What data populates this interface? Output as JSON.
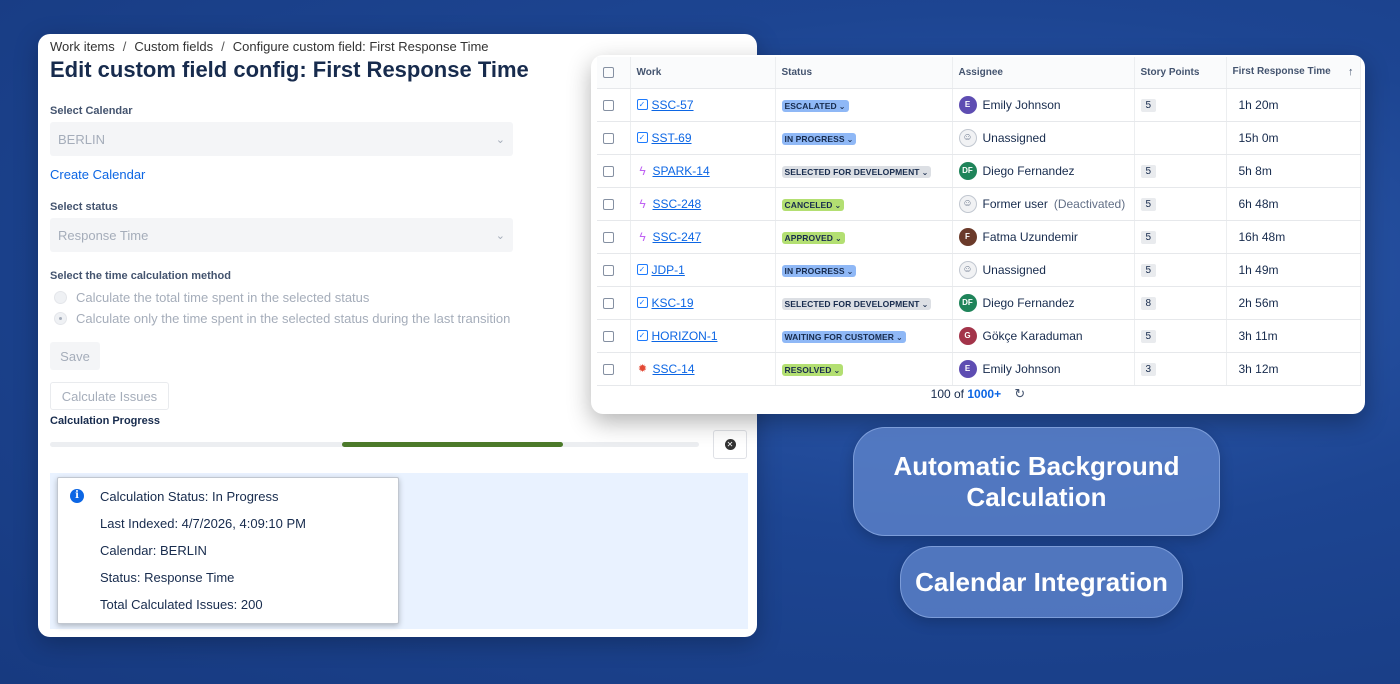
{
  "config": {
    "breadcrumb": [
      "Work items",
      "Custom fields",
      "Configure custom field: First Response Time"
    ],
    "title": "Edit custom field config: First Response Time",
    "calendar_label": "Select Calendar",
    "calendar_value": "BERLIN",
    "create_calendar_link": "Create Calendar",
    "status_label": "Select status",
    "status_value": "Response Time",
    "method_label": "Select the time calculation method",
    "method_options": [
      "Calculate the total time spent in the selected status",
      "Calculate only the time spent in the selected status during the last transition"
    ],
    "method_selected_index": 1,
    "save_label": "Save",
    "calculate_label": "Calculate Issues",
    "progress_label": "Calculation Progress",
    "progress_fraction_start": 0.45,
    "progress_fraction_end": 0.79,
    "info": {
      "status": "Calculation Status: In Progress",
      "last_indexed": "Last Indexed: 4/7/2026, 4:09:10 PM",
      "calendar": "Calendar: BERLIN",
      "status_name": "Status: Response Time",
      "total": "Total Calculated Issues: 200"
    }
  },
  "table": {
    "headers": [
      "Work",
      "Status",
      "Assignee",
      "Story Points",
      "First Response Time"
    ],
    "sort_indicator": "↑",
    "rows": [
      {
        "type": "task",
        "key": "SSC-57",
        "status": "ESCALATED",
        "status_color": "#8fb8f6",
        "assignee": "Emily Johnson",
        "avatar": "E",
        "avatar_color": "#5e4db2",
        "deactivated": "",
        "points": "5",
        "frt": "1h 20m"
      },
      {
        "type": "task",
        "key": "SST-69",
        "status": "IN PROGRESS",
        "status_color": "#8fb8f6",
        "assignee": "Unassigned",
        "avatar": "",
        "avatar_color": "",
        "deactivated": "",
        "points": "",
        "frt": "15h 0m"
      },
      {
        "type": "epic",
        "key": "SPARK-14",
        "status": "SELECTED FOR DEVELOPMENT",
        "status_color": "#dcdfe4",
        "assignee": "Diego Fernandez",
        "avatar": "DF",
        "avatar_color": "#1f845a",
        "deactivated": "",
        "points": "5",
        "frt": "5h 8m"
      },
      {
        "type": "epic",
        "key": "SSC-248",
        "status": "CANCELED",
        "status_color": "#b3df72",
        "assignee": "Former user",
        "avatar": "",
        "avatar_color": "",
        "deactivated": "(Deactivated)",
        "points": "5",
        "frt": "6h 48m"
      },
      {
        "type": "epic",
        "key": "SSC-247",
        "status": "APPROVED",
        "status_color": "#b3df72",
        "assignee": "Fatma Uzundemir",
        "avatar": "F",
        "avatar_color": "#6b3a2a",
        "deactivated": "",
        "points": "5",
        "frt": "16h 48m"
      },
      {
        "type": "task",
        "key": "JDP-1",
        "status": "IN PROGRESS",
        "status_color": "#8fb8f6",
        "assignee": "Unassigned",
        "avatar": "",
        "avatar_color": "",
        "deactivated": "",
        "points": "5",
        "frt": "1h 49m"
      },
      {
        "type": "task",
        "key": "KSC-19",
        "status": "SELECTED FOR DEVELOPMENT",
        "status_color": "#dcdfe4",
        "assignee": "Diego Fernandez",
        "avatar": "DF",
        "avatar_color": "#1f845a",
        "deactivated": "",
        "points": "8",
        "frt": "2h 56m"
      },
      {
        "type": "task",
        "key": "HORIZON-1",
        "status": "WAITING FOR CUSTOMER",
        "status_color": "#8fb8f6",
        "assignee": "Gökçe Karaduman",
        "avatar": "G",
        "avatar_color": "#a3344a",
        "deactivated": "",
        "points": "5",
        "frt": "3h 11m"
      },
      {
        "type": "bug",
        "key": "SSC-14",
        "status": "RESOLVED",
        "status_color": "#b3df72",
        "assignee": "Emily Johnson",
        "avatar": "E",
        "avatar_color": "#5e4db2",
        "deactivated": "",
        "points": "3",
        "frt": "3h 12m"
      }
    ],
    "pager": {
      "shown": "100 of",
      "total": "1000+"
    }
  },
  "features": {
    "background_line1": "Automatic Background",
    "background_line2": "Calculation",
    "calendar": "Calendar Integration"
  }
}
